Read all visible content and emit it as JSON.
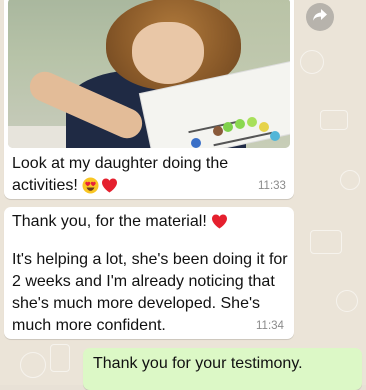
{
  "messages": [
    {
      "direction": "incoming",
      "has_photo": true,
      "text": "Look at my daughter doing the\nactivities!",
      "emojis": [
        "heart-eyes-emoji",
        "red-heart-emoji"
      ],
      "time": "11:33"
    },
    {
      "direction": "incoming",
      "first_line": "Thank you, for the material!",
      "emojis": [
        "red-heart-emoji"
      ],
      "body": "It's helping a lot, she's been doing it for\n2 weeks and I'm already noticing that\nshe's much more developed. She's\nmuch more confident.",
      "time": "11:34"
    },
    {
      "direction": "outgoing",
      "text": "Thank you for your testimony."
    }
  ],
  "icons": {
    "forward": "forward-arrow-icon"
  },
  "colors": {
    "chat_background": "#ebe4d8",
    "incoming_bubble": "#ffffff",
    "outgoing_bubble": "#dcf8c6",
    "timestamp": "#8a8a8a"
  }
}
